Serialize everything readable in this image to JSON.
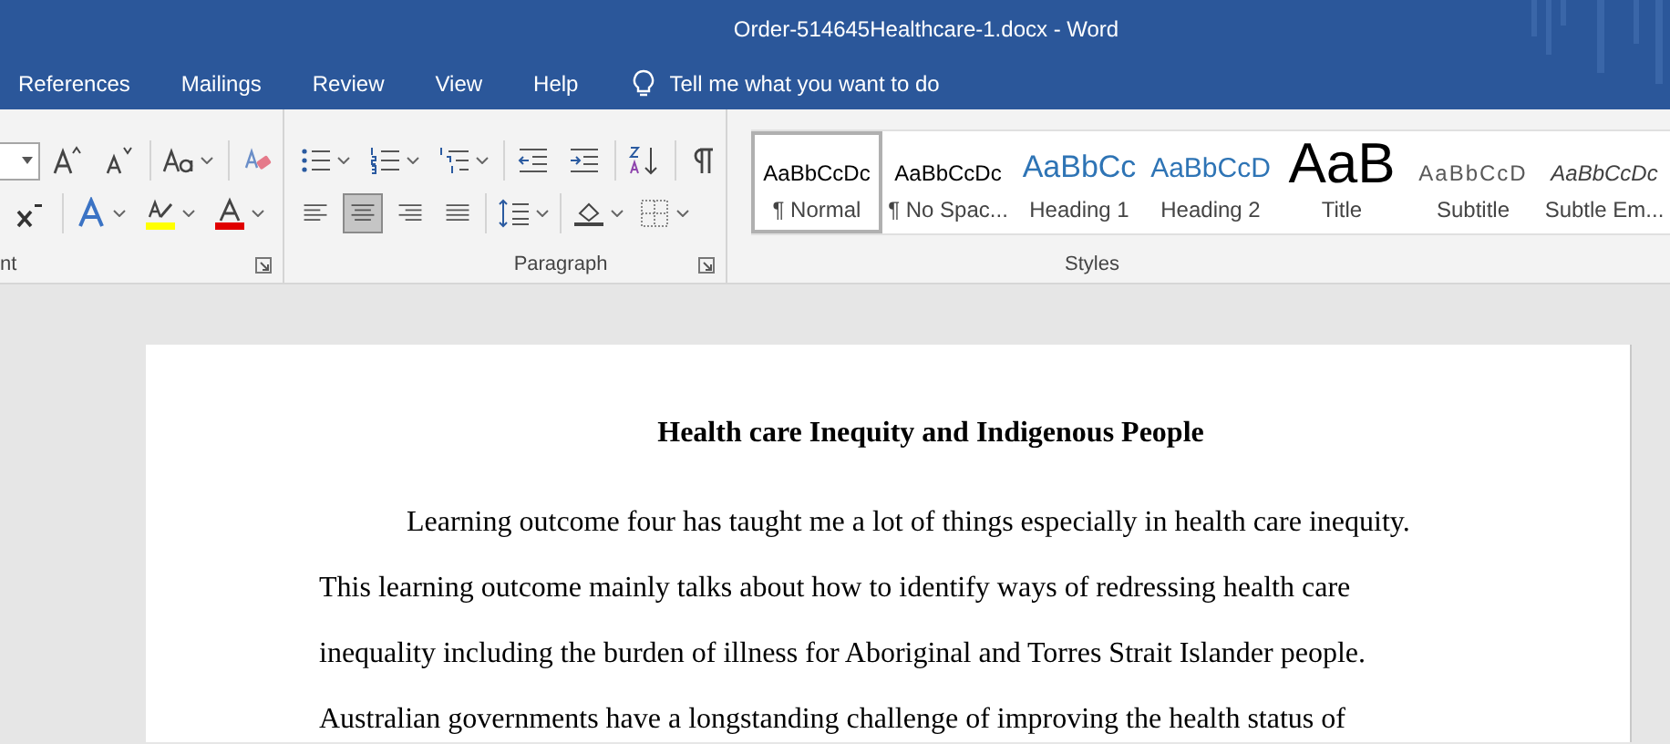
{
  "window": {
    "title": "Order-514645Healthcare-1.docx  -  Word"
  },
  "tabs": [
    {
      "label": "References"
    },
    {
      "label": "Mailings"
    },
    {
      "label": "Review"
    },
    {
      "label": "View"
    },
    {
      "label": "Help"
    }
  ],
  "tell_me": {
    "placeholder": "Tell me what you want to do"
  },
  "ribbon": {
    "groups": [
      {
        "label": "nt"
      },
      {
        "label": "Paragraph"
      },
      {
        "label": "Styles"
      }
    ],
    "align_buttons": [
      {
        "selected": false
      },
      {
        "selected": true
      },
      {
        "selected": false
      },
      {
        "selected": false
      }
    ],
    "styles": [
      {
        "preview": "AaBbCcDc",
        "label": "¶ Normal",
        "kind": "normal",
        "selected": true
      },
      {
        "preview": "AaBbCcDc",
        "label": "¶ No Spac...",
        "kind": "normal",
        "selected": false
      },
      {
        "preview": "AaBbCc",
        "label": "Heading 1",
        "kind": "heading1",
        "selected": false
      },
      {
        "preview": "AaBbCcD",
        "label": "Heading 2",
        "kind": "heading2",
        "selected": false
      },
      {
        "preview": "AaB",
        "label": "Title",
        "kind": "title",
        "selected": false
      },
      {
        "preview": "AaBbCcD",
        "label": "Subtitle",
        "kind": "subtitle",
        "selected": false
      },
      {
        "preview": "AaBbCcDc",
        "label": "Subtle Em...",
        "kind": "emphasis",
        "selected": false
      }
    ]
  },
  "document": {
    "heading": "Health care Inequity and Indigenous People",
    "lines": [
      {
        "text": "Learning outcome four has taught me a lot of things especially in health care inequity.",
        "kind": "first"
      },
      {
        "text": "This learning outcome mainly talks about how to identify ways of redressing health care",
        "kind": "body"
      },
      {
        "text": "inequality including the burden of illness for Aboriginal and Torres Strait Islander people.",
        "kind": "body"
      },
      {
        "text": "Australian governments have a longstanding challenge of improving the health status of",
        "kind": "body"
      }
    ]
  }
}
